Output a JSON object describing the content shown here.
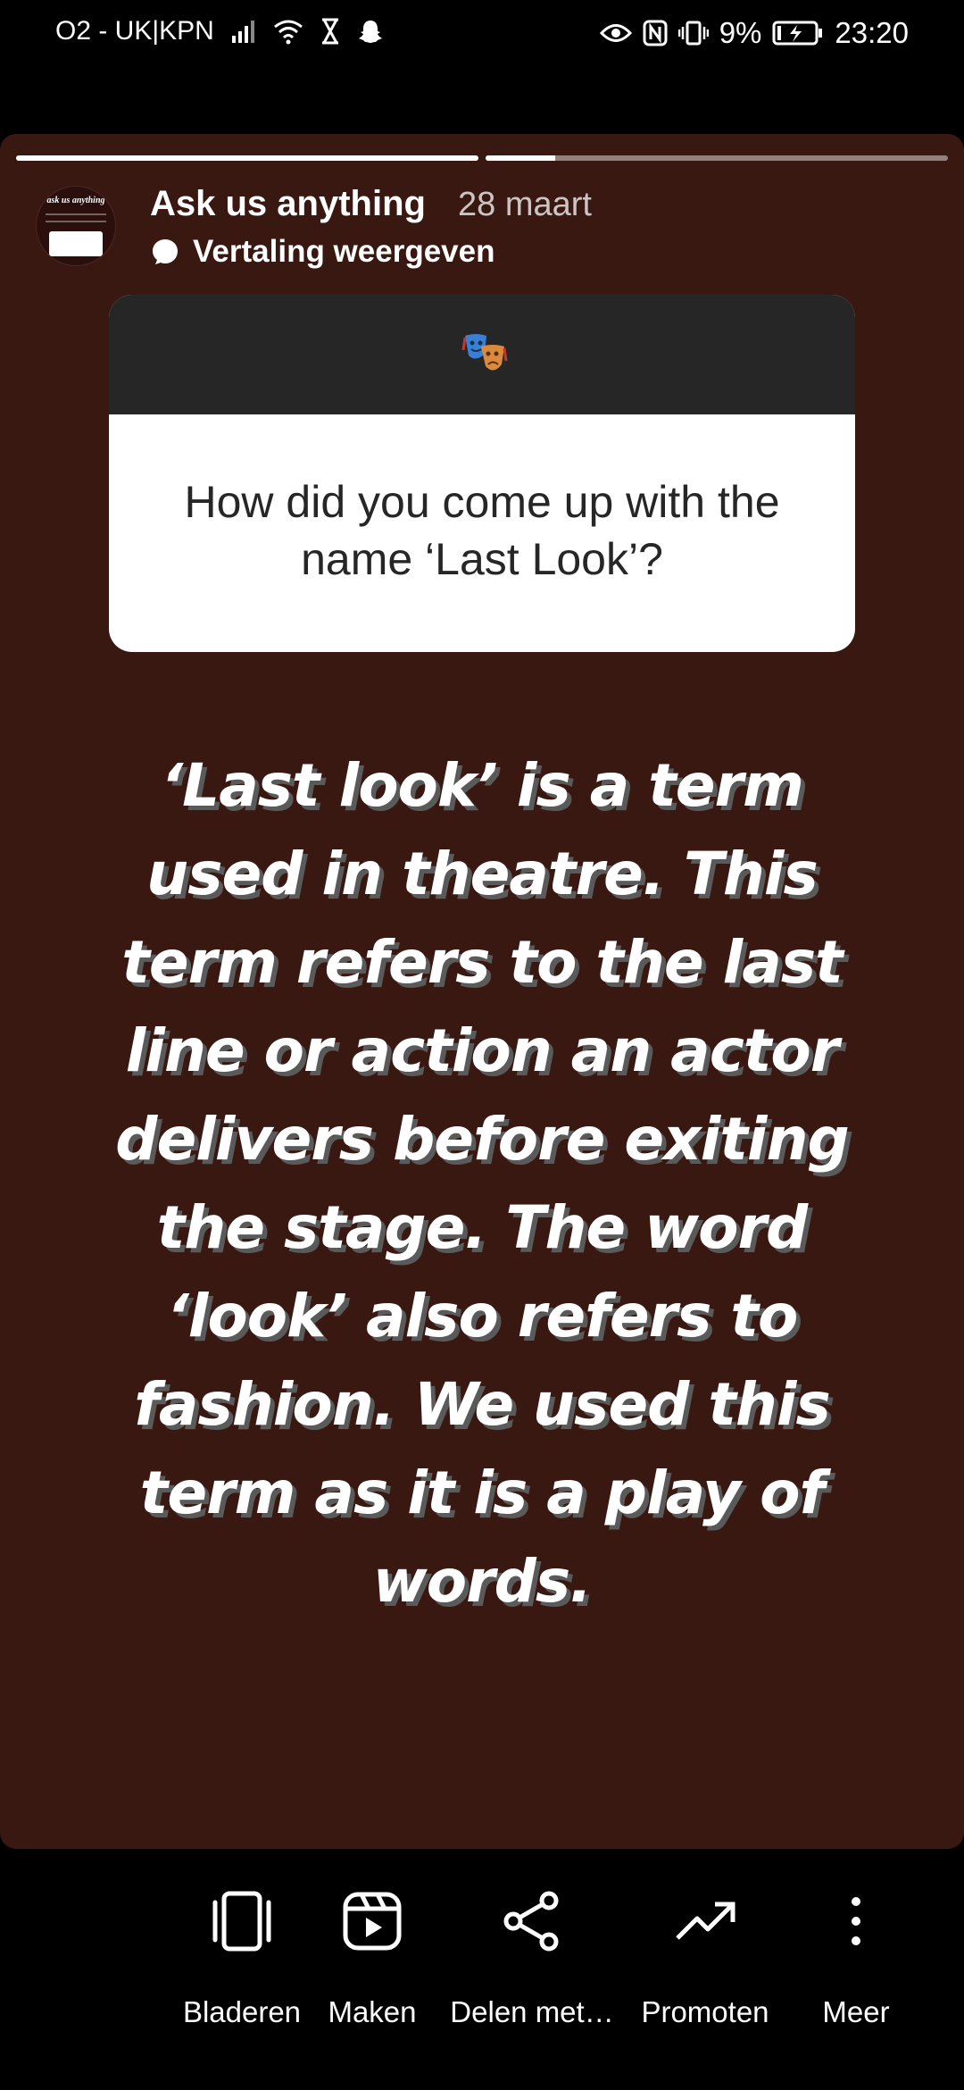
{
  "status_bar": {
    "carrier": "O2 - UK|KPN",
    "battery": "9%",
    "time": "23:20"
  },
  "story": {
    "progress": [
      1.0,
      0.15
    ],
    "account_name": "Ask us anything",
    "date": "28 maart",
    "translate_label": "Vertaling weergeven",
    "avatar_text": "ask us anything",
    "question": "How did you come up with the name ‘Last Look’?",
    "question_emoji_icon": "theatre-masks-icon",
    "answer": "‘Last look’ is a term used in theatre. This term refers to the last line or action an actor delivers before exiting the stage. The word ‘look’ also refers to fashion. We used this term as it is a play of words."
  },
  "actions": [
    {
      "label": "Bladeren",
      "icon": "browse-icon"
    },
    {
      "label": "Maken",
      "icon": "reel-create-icon"
    },
    {
      "label": "Delen met…",
      "icon": "share-icon"
    },
    {
      "label": "Promoten",
      "icon": "trend-up-icon"
    },
    {
      "label": "Meer",
      "icon": "more-vertical-icon"
    }
  ],
  "colors": {
    "story_background": "#3a1812",
    "question_header": "#262626"
  }
}
